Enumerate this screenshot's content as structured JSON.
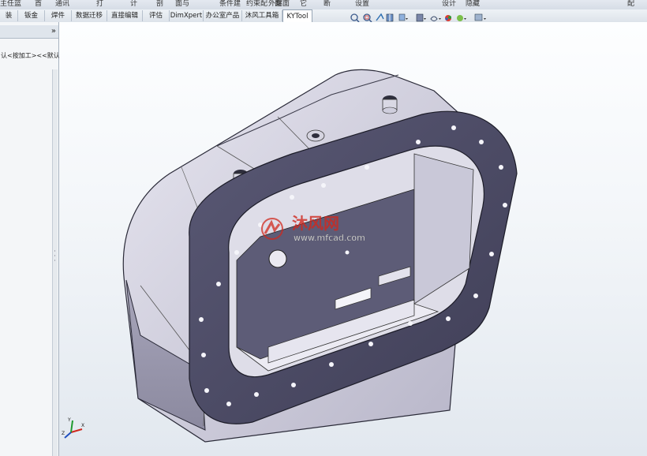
{
  "top_strip": [
    "主任篮",
    "首",
    "通讯",
    "打",
    "计",
    "剖",
    "面与",
    "条件建",
    "约束配",
    "外端面",
    "面",
    "它",
    "断",
    "设置",
    "设计",
    "隐藏",
    "配"
  ],
  "tabs": [
    "装",
    "钣金",
    "焊件",
    "数据迁移",
    "直接编辑",
    "评估",
    "DimXpert",
    "办公室产品",
    "沐风工具箱",
    "KYTool"
  ],
  "active_tab": "KYTool",
  "panel": {
    "collapse_icon": "»",
    "tree_item": "认<按加工><<默认"
  },
  "view_toolbar": [
    "zoom-to-fit-icon",
    "zoom-area-icon",
    "previous-view-icon",
    "section-view-icon",
    "view-orientation-icon",
    "display-style-icon",
    "hide-show-icon",
    "edit-appearance-icon",
    "apply-scene-icon",
    "view-settings-icon"
  ],
  "watermark": {
    "brand": "沐风网",
    "url": "www.mfcad.com"
  },
  "triad": {
    "x": "X",
    "y": "Y",
    "z": "Z"
  },
  "colors": {
    "model_face": "#4b4a64",
    "model_light": "#dcdbe8",
    "model_mid": "#a9a7bc",
    "tab_active": "#ffffff",
    "accent_red": "#d0281e"
  }
}
